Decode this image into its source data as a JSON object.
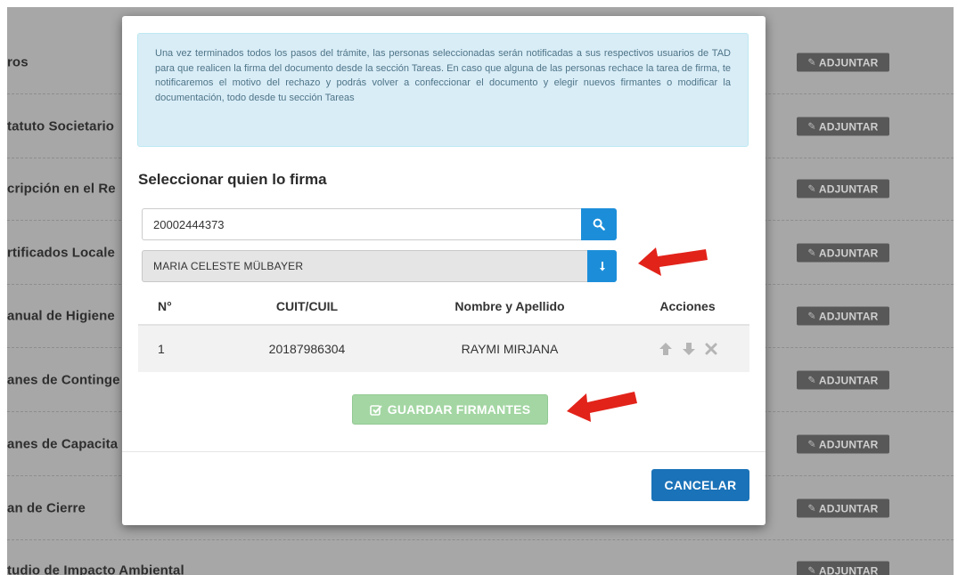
{
  "background": {
    "rows": [
      {
        "label": "ros",
        "button": "ADJUNTAR"
      },
      {
        "label": "tatuto Societario",
        "button": "ADJUNTAR"
      },
      {
        "label": "cripción en el Re",
        "button": "ADJUNTAR"
      },
      {
        "label": "rtificados Locale",
        "button": "ADJUNTAR"
      },
      {
        "label": "anual de Higiene",
        "button": "ADJUNTAR"
      },
      {
        "label": "anes de Continge",
        "button": "ADJUNTAR"
      },
      {
        "label": "anes de Capacita",
        "button": "ADJUNTAR"
      },
      {
        "label": "an de Cierre",
        "button": "ADJUNTAR"
      },
      {
        "label": "tudio de Impacto Ambiental",
        "button": "ADJUNTAR"
      }
    ]
  },
  "modal": {
    "info_text": "Una vez terminados todos los pasos del trámite, las personas seleccionadas serán notificadas a sus respectivos usuarios de TAD para que realicen la firma del documento desde la sección Tareas. En caso que alguna de las personas rechace la tarea de firma, te notificaremos el motivo del rechazo y podrás volver a confeccionar el documento y elegir nuevos firmantes o modificar la documentación, todo desde tu sección Tareas",
    "section_title": "Seleccionar quien lo firma",
    "search": {
      "value": "20002444373",
      "icon": "search-icon"
    },
    "result": {
      "name": "MARIA CELESTE MÜLBAYER",
      "icon": "add-arrow-icon"
    },
    "table": {
      "headers": {
        "num": "N°",
        "cuit": "CUIT/CUIL",
        "name": "Nombre y Apellido",
        "actions": "Acciones"
      },
      "rows": [
        {
          "num": "1",
          "cuit": "20187986304",
          "name": "RAYMI MIRJANA"
        }
      ]
    },
    "save_button": "GUARDAR FIRMANTES",
    "cancel_button": "CANCELAR"
  },
  "colors": {
    "primary": "#1c8ed9",
    "cancel": "#1a72b8",
    "save_disabled": "#a3d6a3",
    "info_bg": "#d9edf7",
    "overlay": "#a7a7a7",
    "arrow": "#e2231a"
  }
}
